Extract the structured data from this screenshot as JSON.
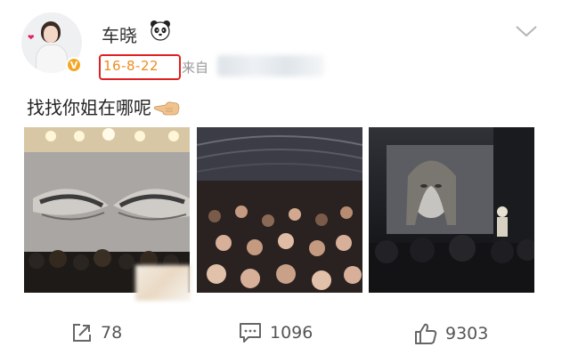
{
  "user": {
    "name": "车晓",
    "verified_badge": "V"
  },
  "post": {
    "date": "16-8-22",
    "source_label": "来自",
    "text": "找找你姐在哪呢",
    "emoji": "pointing-left-hand",
    "images": [
      {
        "description_name": "concert-stage-eyes-photo"
      },
      {
        "description_name": "concert-crowd-photo"
      },
      {
        "description_name": "concert-screen-singer-photo"
      }
    ]
  },
  "actions": {
    "repost_count": "78",
    "comment_count": "1096",
    "like_count": "9303"
  },
  "colors": {
    "date_text": "#f08c22",
    "highlight_box": "#e02020",
    "verified_badge": "#f5a623"
  }
}
